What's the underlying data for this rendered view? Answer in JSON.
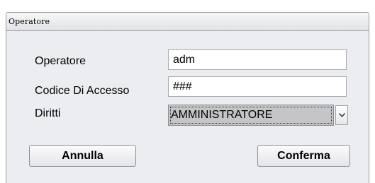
{
  "window": {
    "title": "Operatore"
  },
  "form": {
    "operator_label": "Operatore",
    "operator_value": "adm",
    "access_code_label": "Codice Di Accesso",
    "access_code_value": "###",
    "rights_label": "Diritti",
    "rights_selected": "AMMINISTRATORE"
  },
  "buttons": {
    "cancel_label": "Annulla",
    "confirm_label": "Conferma"
  },
  "icons": {
    "dropdown": "chevron-down-icon"
  }
}
